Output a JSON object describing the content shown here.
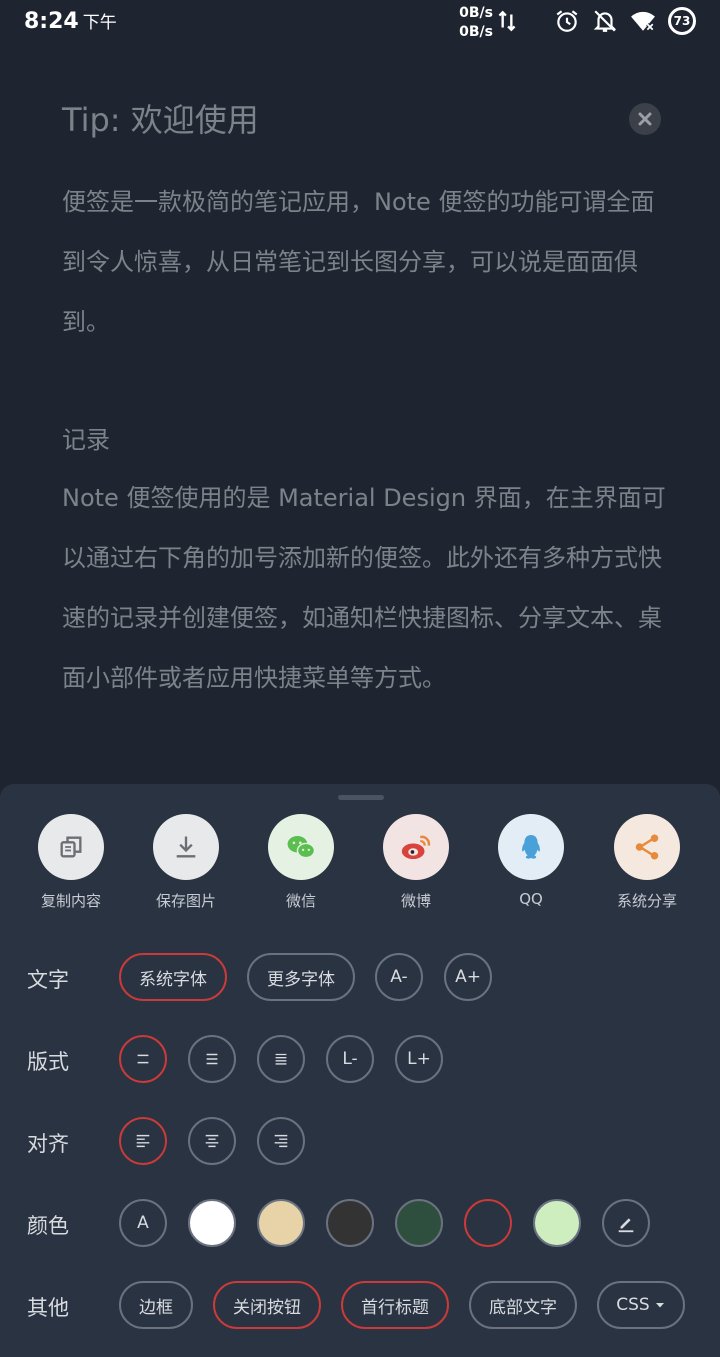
{
  "status_bar": {
    "time": "8:24",
    "ampm": "下午",
    "upload_speed": "0B/s",
    "download_speed": "0B/s",
    "battery_level": "73"
  },
  "note": {
    "title": "Tip: 欢迎使用",
    "paragraphs": [
      "便签是一款极简的笔记应用，Note 便签的功能可谓全面到令人惊喜，从日常笔记到长图分享，可以说是面面俱到。",
      "记录",
      "Note 便签使用的是 Material Design 界面，在主界面可以通过右下角的加号添加新的便签。此外还有多种方式快速的记录并创建便签，如通知栏快捷图标、分享文本、桌面小部件或者应用快捷菜单等方式。"
    ]
  },
  "share": {
    "items": [
      {
        "label": "复制内容",
        "icon": "copy-icon",
        "bg": "#e8e9eb",
        "color": "#6b6e73"
      },
      {
        "label": "保存图片",
        "icon": "download-icon",
        "bg": "#e8e9eb",
        "color": "#6b6e73"
      },
      {
        "label": "微信",
        "icon": "wechat-icon",
        "bg": "#e5f2e3",
        "color": "#5bbf4f"
      },
      {
        "label": "微博",
        "icon": "weibo-icon",
        "bg": "#f3e4e4",
        "color": "#d8433b"
      },
      {
        "label": "QQ",
        "icon": "qq-icon",
        "bg": "#e2edf5",
        "color": "#4aa0d8"
      },
      {
        "label": "系统分享",
        "icon": "share-icon",
        "bg": "#f5e8de",
        "color": "#e88a3c"
      }
    ]
  },
  "options": {
    "text": {
      "label": "文字",
      "buttons": [
        "系统字体",
        "更多字体",
        "A-",
        "A+"
      ]
    },
    "layout": {
      "label": "版式",
      "buttons": [
        "L-",
        "L+"
      ]
    },
    "align": {
      "label": "对齐"
    },
    "color": {
      "label": "颜色",
      "auto_label": "A",
      "swatches": [
        "#ffffff",
        "#e8d2a8",
        "#333333",
        "#2f4f3e",
        "#2a3341",
        "#cfeec0"
      ]
    },
    "other": {
      "label": "其他",
      "buttons": [
        "边框",
        "关闭按钮",
        "首行标题",
        "底部文字",
        "CSS"
      ]
    }
  },
  "colors": {
    "accent": "#c93a3a",
    "sheet_bg": "#2a3341",
    "page_bg": "#1f2530"
  }
}
